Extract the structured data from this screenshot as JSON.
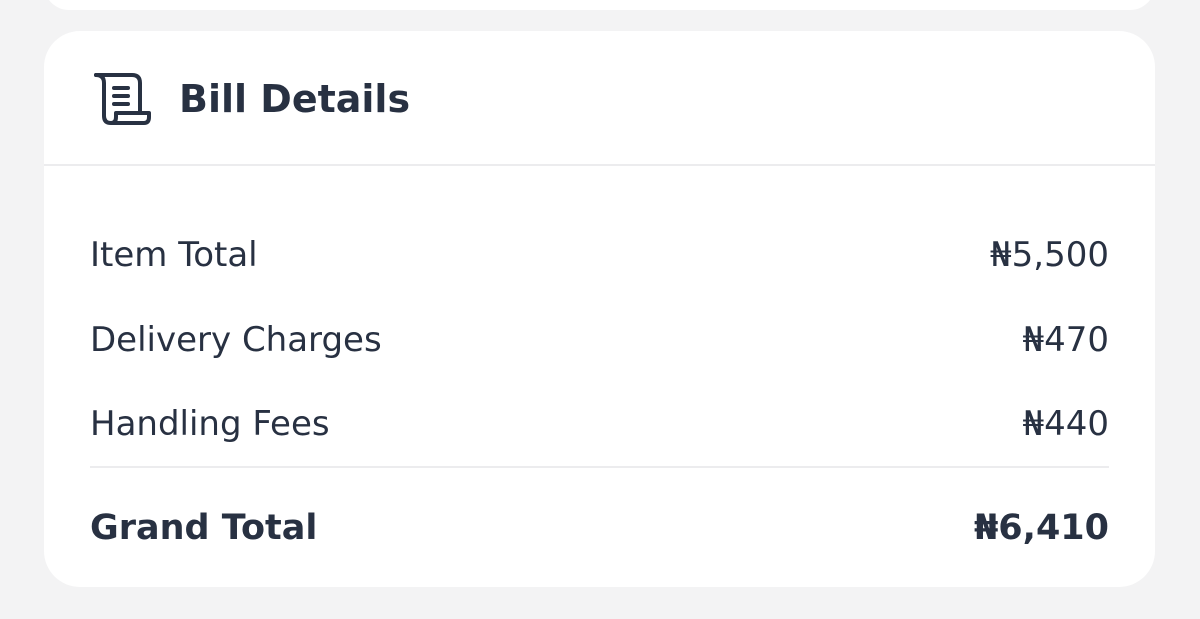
{
  "bill": {
    "icon": "receipt-scroll-icon",
    "title": "Bill Details",
    "items": [
      {
        "label": "Item Total",
        "amount": "₦5,500"
      },
      {
        "label": "Delivery Charges",
        "amount": "₦470"
      },
      {
        "label": "Handling Fees",
        "amount": "₦440"
      }
    ],
    "grand_total": {
      "label": "Grand Total",
      "amount": "₦6,410"
    }
  },
  "colors": {
    "background": "#f3f3f4",
    "card": "#ffffff",
    "text": "#283142",
    "divider": "#ececee"
  }
}
